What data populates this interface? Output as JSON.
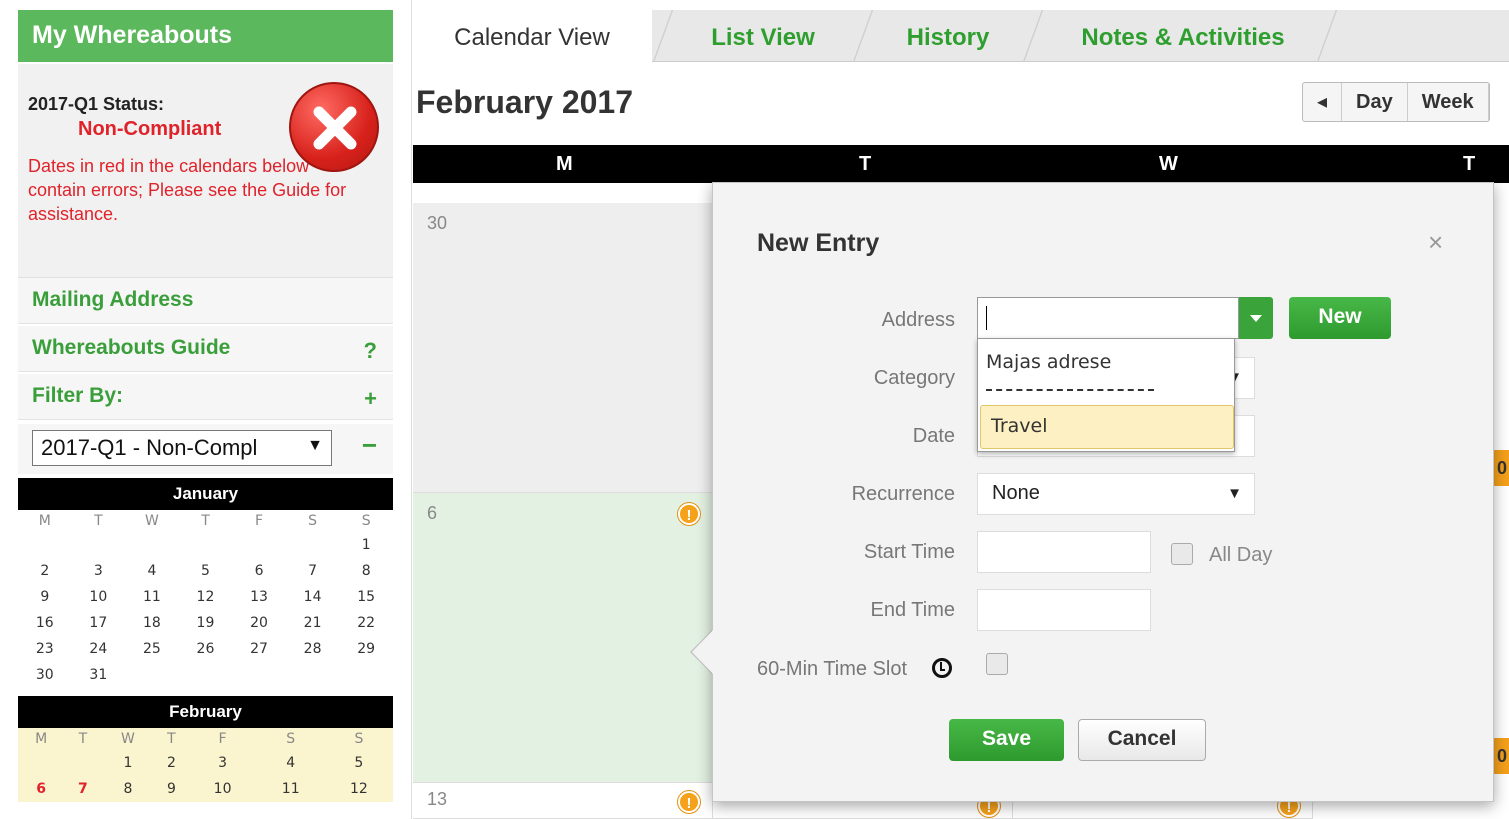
{
  "sidebar": {
    "title": "My Whereabouts",
    "status": {
      "title": "2017-Q1 Status:",
      "value": "Non-Compliant",
      "message": "Dates in red in the calendars below contain errors; Please see the Guide for assistance.",
      "icon": "error-x-icon"
    },
    "mailing_address": "Mailing Address",
    "guide": "Whereabouts Guide",
    "guide_icon": "?",
    "filter_label": "Filter By:",
    "filter_plus": "+",
    "filter_value": "2017-Q1 - Non-Compl",
    "filter_minus": "−",
    "jan": {
      "title": "January",
      "weekdays": [
        "M",
        "T",
        "W",
        "T",
        "F",
        "S",
        "S"
      ],
      "weeks": [
        [
          "",
          "",
          "",
          "",
          "",
          "",
          "1"
        ],
        [
          "2",
          "3",
          "4",
          "5",
          "6",
          "7",
          "8"
        ],
        [
          "9",
          "10",
          "11",
          "12",
          "13",
          "14",
          "15"
        ],
        [
          "16",
          "17",
          "18",
          "19",
          "20",
          "21",
          "22"
        ],
        [
          "23",
          "24",
          "25",
          "26",
          "27",
          "28",
          "29"
        ],
        [
          "30",
          "31",
          "",
          "",
          "",
          "",
          ""
        ]
      ]
    },
    "feb": {
      "title": "February",
      "weekdays": [
        "M",
        "T",
        "W",
        "T",
        "F",
        "S",
        "S"
      ],
      "weeks": [
        [
          "",
          "",
          "1",
          "2",
          "3",
          "4",
          "5"
        ],
        [
          "6",
          "7",
          "8",
          "9",
          "10",
          "11",
          "12"
        ]
      ],
      "red_days": [
        "6",
        "7"
      ]
    }
  },
  "tabs": [
    {
      "label": "Calendar View",
      "active": true
    },
    {
      "label": "List View",
      "active": false
    },
    {
      "label": "History",
      "active": false
    },
    {
      "label": "Notes & Activities",
      "active": false
    }
  ],
  "main": {
    "month_title": "February 2017",
    "view_buttons": [
      "◂",
      "Day",
      "Week"
    ],
    "weekdays": [
      "M",
      "T",
      "W",
      "T"
    ],
    "cells": {
      "d30": "30",
      "d6": "6",
      "d13": "13"
    },
    "orange_tab": "0"
  },
  "dialog": {
    "title": "New Entry",
    "close": "×",
    "address_label": "Address",
    "address_value": "",
    "new_button": "New",
    "address_options": [
      "Majas adrese",
      "Travel"
    ],
    "category_label": "Category",
    "date_label": "Date",
    "recurrence_label": "Recurrence",
    "recurrence_value": "None",
    "start_label": "Start Time",
    "end_label": "End Time",
    "allday_label": "All Day",
    "slot_label": "60-Min Time Slot",
    "save_button": "Save",
    "cancel_button": "Cancel"
  },
  "colors": {
    "brand_green": "#5cb85c",
    "error_red": "#e0232b",
    "warning_orange": "#f5a11a"
  }
}
